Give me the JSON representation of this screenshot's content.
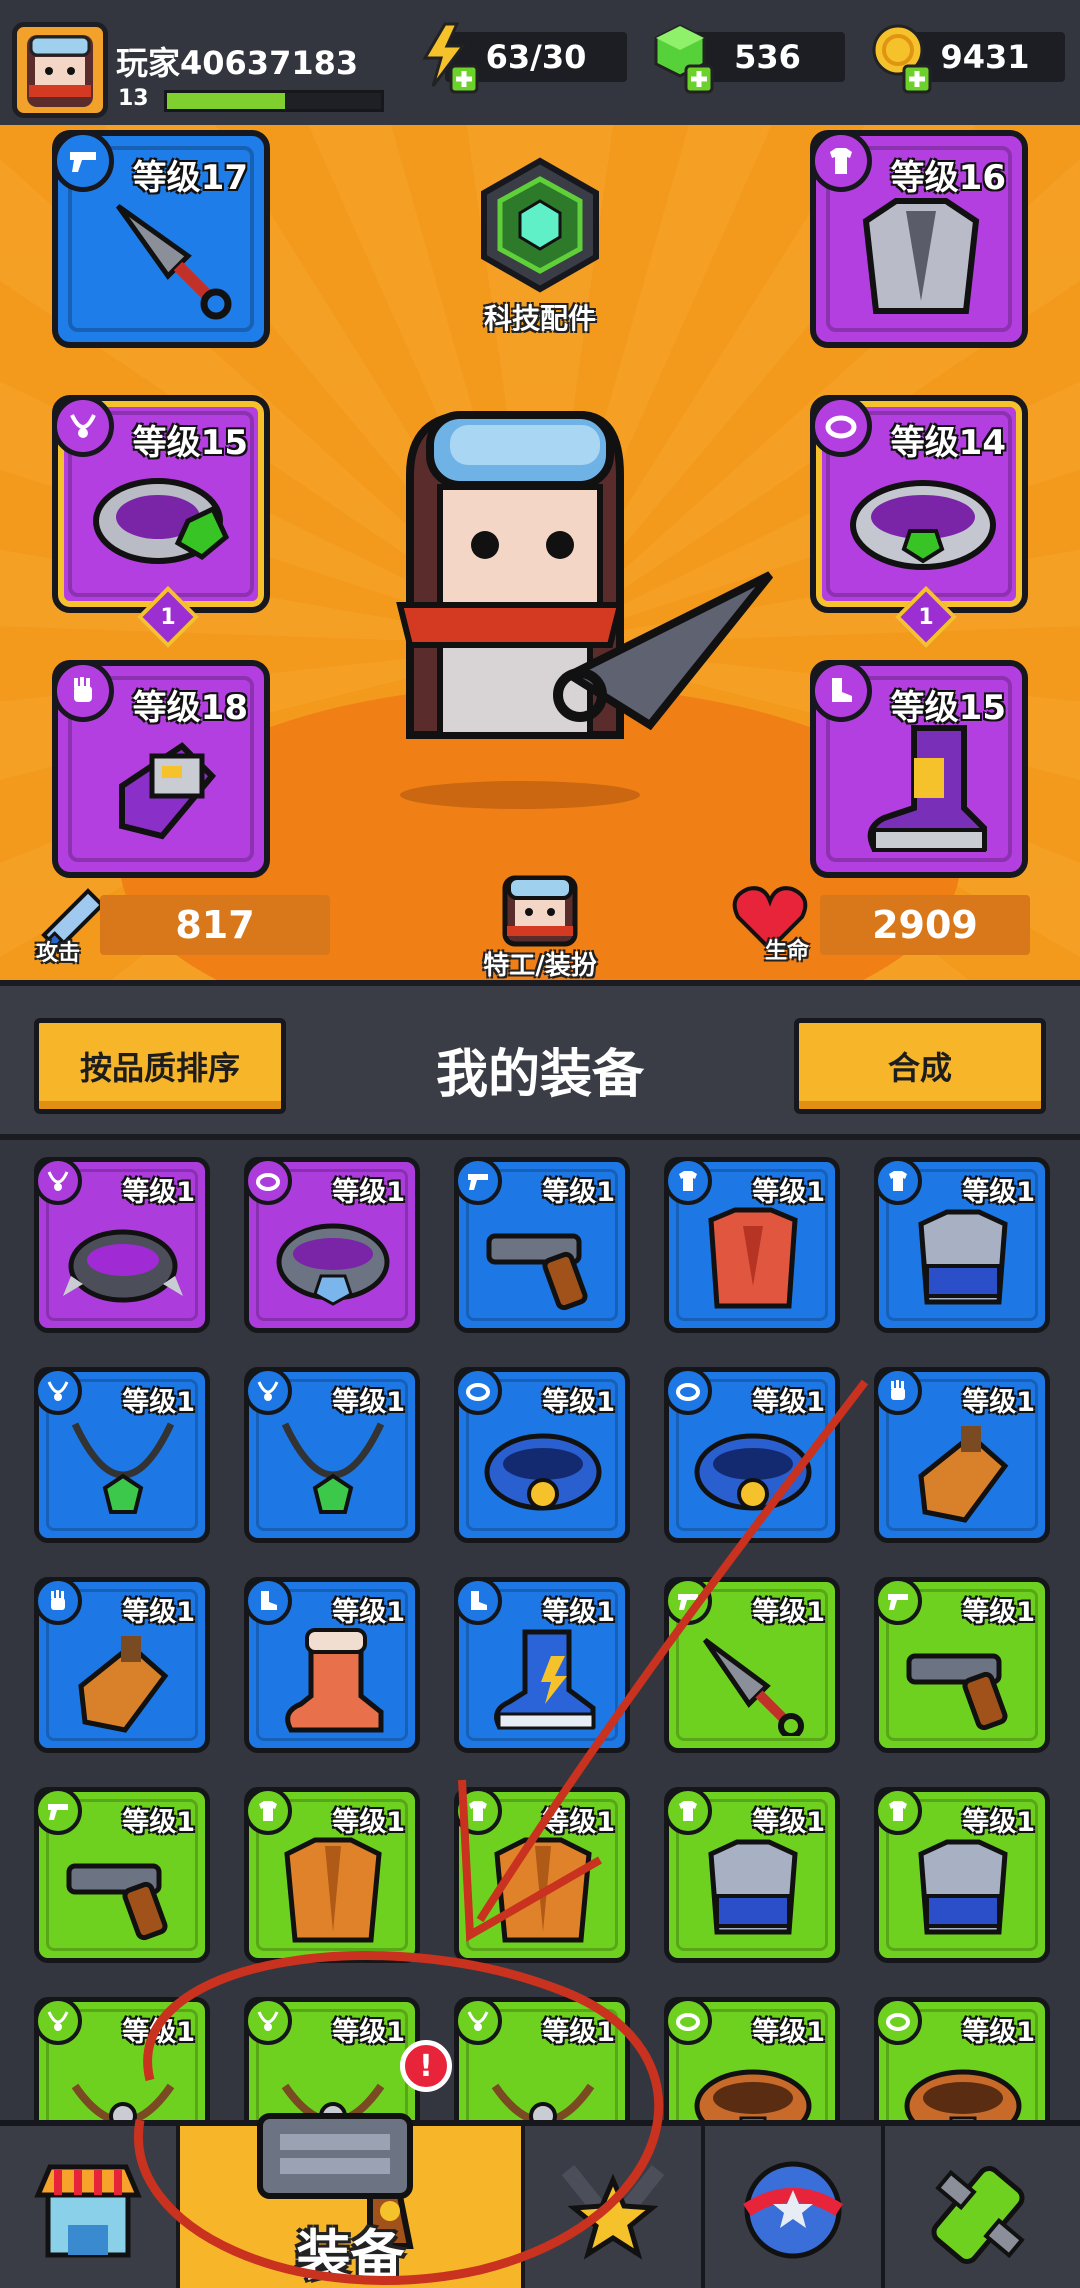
{
  "player": {
    "name": "玩家40637183",
    "level": "13",
    "xp_progress": 0.55
  },
  "resources": {
    "energy": "63/30",
    "gems": "536",
    "coins": "9431"
  },
  "hero": {
    "tech_label": "科技配件",
    "agent_label": "特工/装扮",
    "attack_label": "攻击",
    "attack_value": "817",
    "hp_label": "生命",
    "hp_value": "2909",
    "slots": {
      "weapon": {
        "level": "等级17",
        "type_icon": "gun-icon"
      },
      "armor": {
        "level": "等级16",
        "type_icon": "shirt-icon"
      },
      "necklace": {
        "level": "等级15",
        "stars": "1",
        "type_icon": "necklace-icon"
      },
      "ring": {
        "level": "等级14",
        "stars": "1",
        "type_icon": "ring-icon"
      },
      "gloves": {
        "level": "等级18",
        "type_icon": "glove-icon"
      },
      "boots": {
        "level": "等级15",
        "type_icon": "boot-icon"
      }
    }
  },
  "equipment": {
    "sort_button": "按品质排序",
    "title": "我的装备",
    "merge_button": "合成",
    "items": [
      {
        "level": "等级1",
        "rarity": "purple",
        "kind": "necklace",
        "art": "spiked-collar"
      },
      {
        "level": "等级1",
        "rarity": "purple",
        "kind": "ring",
        "art": "silver-ring"
      },
      {
        "level": "等级1",
        "rarity": "blue",
        "kind": "weapon",
        "art": "revolver"
      },
      {
        "level": "等级1",
        "rarity": "blue",
        "kind": "armor",
        "art": "red-vest"
      },
      {
        "level": "等级1",
        "rarity": "blue",
        "kind": "armor",
        "art": "armor-vest"
      },
      {
        "level": "等级1",
        "rarity": "blue",
        "kind": "necklace",
        "art": "green-pendant"
      },
      {
        "level": "等级1",
        "rarity": "blue",
        "kind": "necklace",
        "art": "green-pendant"
      },
      {
        "level": "等级1",
        "rarity": "blue",
        "kind": "ring",
        "art": "blue-ring"
      },
      {
        "level": "等级1",
        "rarity": "blue",
        "kind": "ring",
        "art": "blue-ring"
      },
      {
        "level": "等级1",
        "rarity": "blue",
        "kind": "gloves",
        "art": "brown-glove"
      },
      {
        "level": "等级1",
        "rarity": "blue",
        "kind": "gloves",
        "art": "brown-glove"
      },
      {
        "level": "等级1",
        "rarity": "blue",
        "kind": "boots",
        "art": "fur-boot"
      },
      {
        "level": "等级1",
        "rarity": "blue",
        "kind": "boots",
        "art": "sneaker"
      },
      {
        "level": "等级1",
        "rarity": "green",
        "kind": "weapon",
        "art": "kunai"
      },
      {
        "level": "等级1",
        "rarity": "green",
        "kind": "weapon",
        "art": "revolver"
      },
      {
        "level": "等级1",
        "rarity": "green",
        "kind": "weapon",
        "art": "revolver"
      },
      {
        "level": "等级1",
        "rarity": "green",
        "kind": "armor",
        "art": "jacket"
      },
      {
        "level": "等级1",
        "rarity": "green",
        "kind": "armor",
        "art": "jacket"
      },
      {
        "level": "等级1",
        "rarity": "green",
        "kind": "armor",
        "art": "armor-vest"
      },
      {
        "level": "等级1",
        "rarity": "green",
        "kind": "armor",
        "art": "armor-vest"
      },
      {
        "level": "等级1",
        "rarity": "green",
        "kind": "necklace",
        "art": "rope-necklace"
      },
      {
        "level": "等级1",
        "rarity": "green",
        "kind": "necklace",
        "art": "rope-necklace"
      },
      {
        "level": "等级1",
        "rarity": "green",
        "kind": "necklace",
        "art": "rope-necklace"
      },
      {
        "level": "等级1",
        "rarity": "green",
        "kind": "ring",
        "art": "belt"
      },
      {
        "level": "等级1",
        "rarity": "green",
        "kind": "ring",
        "art": "belt"
      }
    ]
  },
  "nav": {
    "tabs": [
      "shop-icon",
      "equipment-icon",
      "skills-icon",
      "stars-icon",
      "dna-icon"
    ],
    "active_label": "装备",
    "alert": "!"
  },
  "colors": {
    "hero_bg": "#f39a1c",
    "purple": "#ac3ddc",
    "blue": "#1d78e6",
    "green": "#6fd11f",
    "button_yellow": "#f7b52a",
    "annotation_red": "#c8321e"
  }
}
